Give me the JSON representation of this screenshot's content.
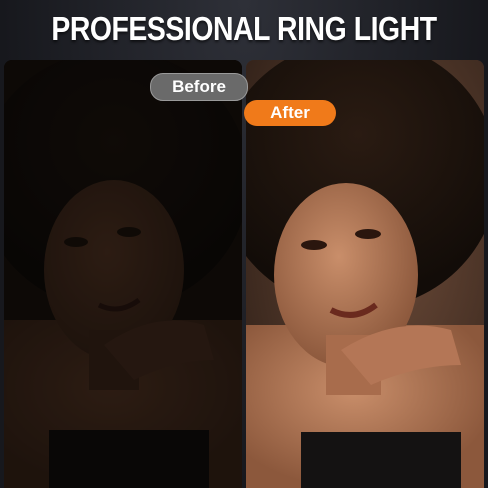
{
  "header": {
    "title": "PROFESSIONAL RING LIGHT"
  },
  "labels": {
    "before": "Before",
    "after": "After"
  },
  "colors": {
    "after_badge": "#f07a1a",
    "before_badge": "#6a6a6a",
    "title_text": "#ffffff"
  }
}
